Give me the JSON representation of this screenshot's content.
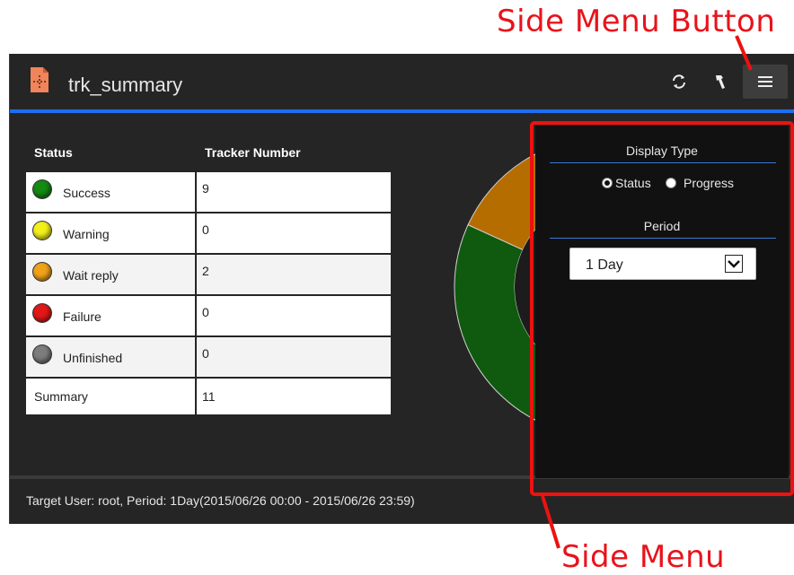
{
  "annotations": {
    "side_menu_button": "Side Menu Button",
    "side_menu": "Side Menu"
  },
  "window": {
    "title": "trk_summary",
    "toolbar": {
      "refresh_icon": "refresh-icon",
      "wrench_icon": "wrench-icon",
      "menu_icon": "hamburger-menu-icon"
    }
  },
  "table": {
    "headers": [
      "Status",
      "Tracker Number"
    ],
    "rows": [
      {
        "label": "Success",
        "value": "9",
        "color": "#138a12"
      },
      {
        "label": "Warning",
        "value": "0",
        "color": "#f2ef1a"
      },
      {
        "label": "Wait reply",
        "value": "2",
        "color": "#f0a21a"
      },
      {
        "label": "Failure",
        "value": "0",
        "color": "#e21818"
      },
      {
        "label": "Unfinished",
        "value": "0",
        "color": "#7d7d7d"
      }
    ],
    "summary": {
      "label": "Summary",
      "value": "11"
    }
  },
  "chart_data": {
    "type": "pie",
    "categories": [
      "Success",
      "Warning",
      "Wait reply",
      "Failure",
      "Unfinished"
    ],
    "values": [
      9,
      0,
      2,
      0,
      0
    ],
    "colors": [
      "#0f5a0f",
      "#f2ef1a",
      "#b56d00",
      "#e21818",
      "#7d7d7d"
    ],
    "style": "donut"
  },
  "side_menu": {
    "display_type": {
      "title": "Display Type",
      "options": [
        "Status",
        "Progress"
      ],
      "selected": "Status"
    },
    "period": {
      "title": "Period",
      "selected": "1 Day"
    }
  },
  "footer": {
    "text": "Target User: root, Period: 1Day(2015/06/26 00:00 - 2015/06/26 23:59)"
  }
}
